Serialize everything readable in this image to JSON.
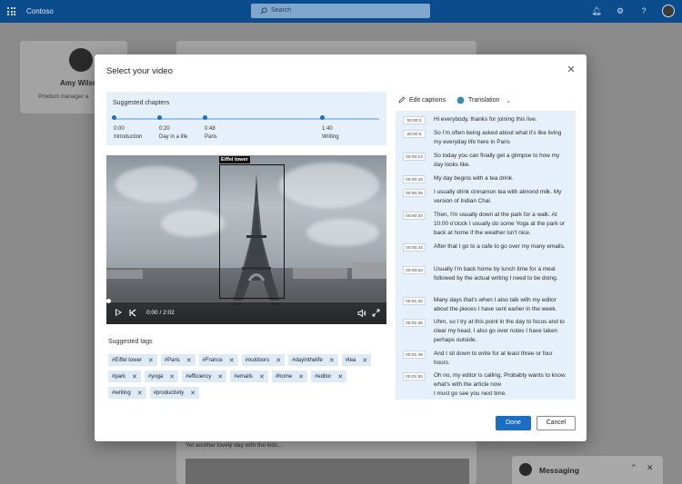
{
  "app": {
    "brand": "Contoso",
    "search_placeholder": "Search"
  },
  "profile": {
    "name": "Amy Wilso",
    "role": "Product manager a"
  },
  "feed": {
    "post_text": "Yet another lovely day with the kids..."
  },
  "messaging": {
    "label": "Messaging"
  },
  "modal": {
    "title": "Select your video",
    "chapters": {
      "title": "Suggested chapters",
      "items": [
        {
          "time": "0:00",
          "name": "Introduction"
        },
        {
          "time": "0:20",
          "name": "Day in a life"
        },
        {
          "time": "0:48",
          "name": "Paris"
        },
        {
          "time": "1:40",
          "name": "Writing"
        }
      ]
    },
    "video": {
      "detection_label": "Eiffel tower",
      "time": "0:00 / 2:02",
      "progress": 0
    },
    "tags": {
      "title": "Suggested tags",
      "items": [
        "#Eiffel tower",
        "#Paris",
        "#France",
        "#outdoors",
        "#dayinthelife",
        "#tea",
        "#park",
        "#yoga",
        "#efficiency",
        "#emails",
        "#home",
        "#editor",
        "#writing",
        "#productivity"
      ]
    },
    "captions": {
      "edit_label": "Edit captions",
      "translation_label": "Translation",
      "lines": [
        {
          "time": "00:00:2",
          "text": "Hi everybody, thanks for joining this live."
        },
        {
          "time": "00:00:6",
          "text": "So I'm often being asked about what it's like living my everyday life here in Paris"
        },
        {
          "time": "00:00:13",
          "text": "So today you can finally get a glimpse to how my day looks like."
        },
        {
          "time": "00:00:19",
          "text": "My day begins with a tea drink."
        },
        {
          "time": "00:00:25",
          "text": "I usually drink cinnamon tea with almond milk. My version of Indian Chai."
        },
        {
          "time": "00:00:34",
          "text": "Then, I'm usually down at the park for a walk. At 10:00 o'clock I usually do some Yoga at the park or back at home if the weather isn't nice."
        },
        {
          "time": "00:00:44",
          "text": "After that I go to a cafe to go over my many emails."
        },
        {
          "time": "00:00:53",
          "text": "Usually I'm back home by lunch time for a meal followed by the actual writing I need to be doing."
        },
        {
          "time": "00:01:22",
          "text": "Many days that's when I also talk with my editor about the pieces I have sent earlier in the week."
        },
        {
          "time": "00:01:35",
          "text": "Uhm, so I try at this point in the day to focus and to clear my head, I also go over notes I have taken perhaps outside."
        },
        {
          "time": "00:01:49",
          "text": "And I sit down to write for at least three or four hours."
        },
        {
          "time": "00:01:55",
          "text": "Oh no, my editor is calling. Probably wants to know what's with the article now\nI must go see you next time."
        }
      ]
    },
    "done_label": "Done",
    "cancel_label": "Cancel"
  }
}
